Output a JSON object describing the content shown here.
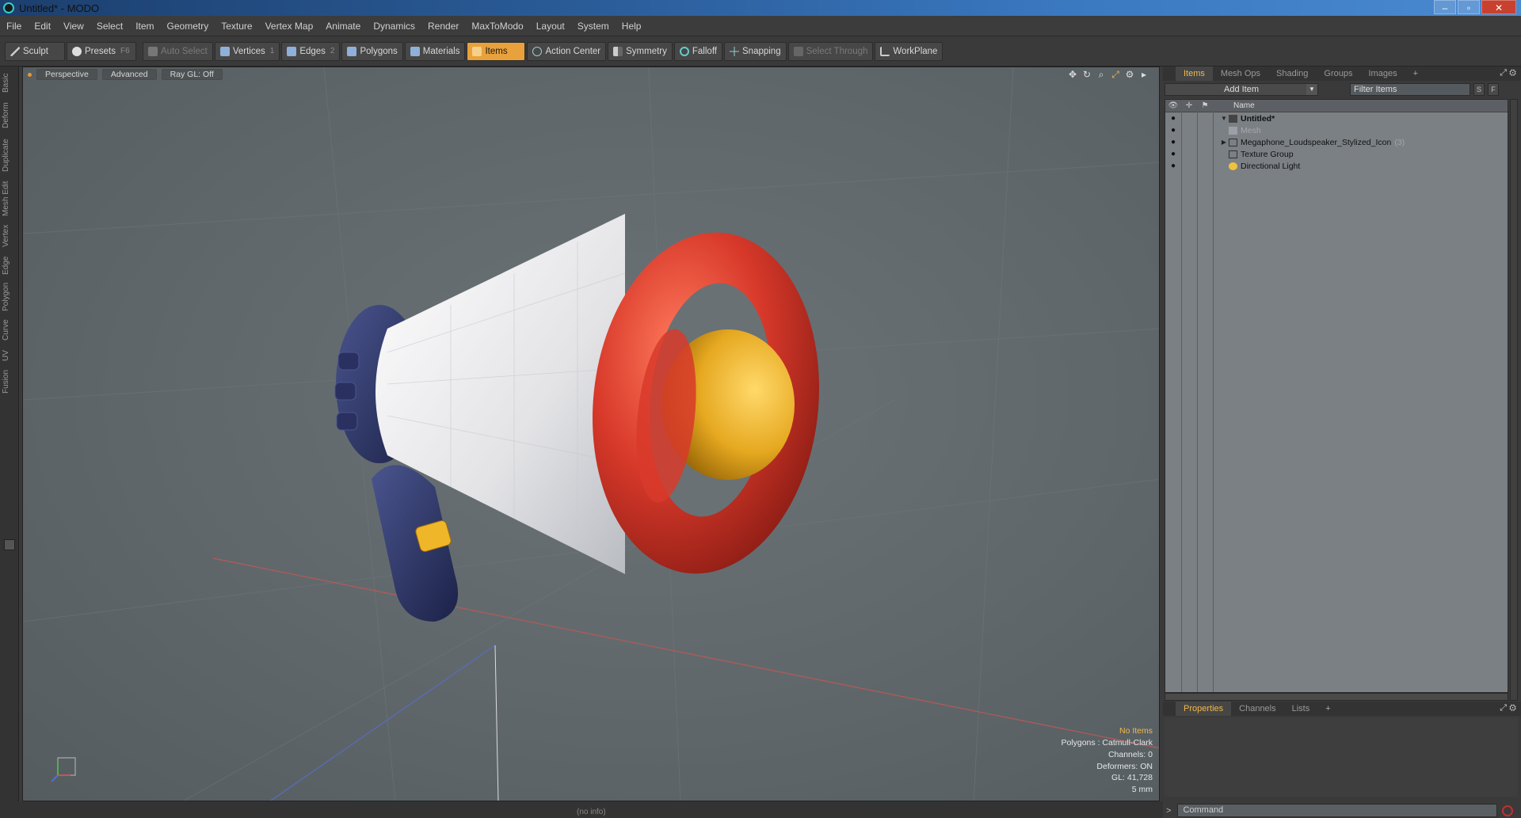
{
  "window": {
    "title": "Untitled* - MODO",
    "min": "–",
    "max": "▫",
    "close": "✕"
  },
  "menu": [
    "File",
    "Edit",
    "View",
    "Select",
    "Item",
    "Geometry",
    "Texture",
    "Vertex Map",
    "Animate",
    "Dynamics",
    "Render",
    "MaxToModo",
    "Layout",
    "System",
    "Help"
  ],
  "toolbar": {
    "sculpt": "Sculpt",
    "presets": "Presets",
    "presets_key": "F6",
    "auto_select": "Auto Select",
    "vertices": "Vertices",
    "vertices_key": "1",
    "edges": "Edges",
    "edges_key": "2",
    "polygons": "Polygons",
    "materials": "Materials",
    "items": "Items",
    "action_center": "Action Center",
    "symmetry": "Symmetry",
    "falloff": "Falloff",
    "snapping": "Snapping",
    "select_through": "Select Through",
    "workplane": "WorkPlane"
  },
  "left_tabs": [
    "Basic",
    "Deform",
    "Duplicate",
    "Mesh Edit",
    "Vertex",
    "Edge",
    "Polygon",
    "Curve",
    "UV",
    "Fusion"
  ],
  "viewport": {
    "tabs": [
      "Perspective",
      "Advanced",
      "Ray GL: Off"
    ],
    "info": {
      "selection": "No Items",
      "polygons": "Polygons : Catmull-Clark",
      "channels": "Channels: 0",
      "deformers": "Deformers: ON",
      "gl": "GL: 41,728",
      "grid": "5 mm"
    }
  },
  "panel": {
    "tabs": [
      "Items",
      "Mesh Ops",
      "Shading",
      "Groups",
      "Images",
      "+"
    ],
    "add_item": "Add Item",
    "filter_placeholder": "Filter Items",
    "s_btn": "S",
    "f_btn": "F",
    "name_header": "Name",
    "tree": [
      {
        "label": "Untitled*",
        "count": ""
      },
      {
        "label": "Mesh",
        "count": ""
      },
      {
        "label": "Megaphone_Loudspeaker_Stylized_Icon",
        "count": "(3)"
      },
      {
        "label": "Texture Group",
        "count": ""
      },
      {
        "label": "Directional Light",
        "count": ""
      }
    ],
    "bottom_tabs": [
      "Properties",
      "Channels",
      "Lists",
      "+"
    ]
  },
  "status": {
    "info": "(no info)"
  },
  "command": {
    "prompt": ">",
    "placeholder": "Command"
  },
  "colors": {
    "accent": "#e9a13b",
    "megaphone_red": "#d8392a",
    "megaphone_yellow": "#e6a820",
    "handle_navy": "#2c3566",
    "body_white": "#e8e8e8"
  }
}
